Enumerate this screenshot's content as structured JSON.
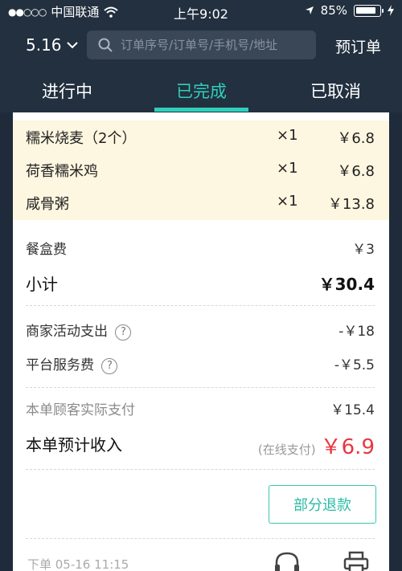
{
  "status_bar": {
    "carrier": "中国联通",
    "time": "上午9:02",
    "battery": "85%"
  },
  "header": {
    "date": "5.16",
    "search_placeholder": "订单序号/订单号/手机号/地址",
    "reserve_label": "预订单"
  },
  "tabs": [
    {
      "label": "进行中"
    },
    {
      "label": "已完成"
    },
    {
      "label": "已取消"
    }
  ],
  "items": [
    {
      "name": "糯米烧麦（2个）",
      "qty": "×1",
      "price": "￥6.8"
    },
    {
      "name": "荷香糯米鸡",
      "qty": "×1",
      "price": "￥6.8"
    },
    {
      "name": "咸骨粥",
      "qty": "×1",
      "price": "￥13.8"
    }
  ],
  "fees": {
    "box_fee_label": "餐盒费",
    "box_fee_value": "￥3",
    "subtotal_label": "小计",
    "subtotal_value": "￥30.4",
    "merchant_activity_label": "商家活动支出",
    "merchant_activity_value": "-￥18",
    "platform_fee_label": "平台服务费",
    "platform_fee_value": "-￥5.5",
    "customer_paid_label": "本单顾客实际支付",
    "customer_paid_value": "￥15.4",
    "income_label": "本单预计收入",
    "income_note": "(在线支付)",
    "income_value": "￥6.9"
  },
  "actions": {
    "refund_label": "部分退款"
  },
  "footer": {
    "time_partial": "下单 05-16 11:15"
  },
  "colors": {
    "header_bg": "#22303f",
    "accent": "#2fcfbb",
    "income_red": "#e8373f",
    "items_bg": "#fdf6e0"
  }
}
